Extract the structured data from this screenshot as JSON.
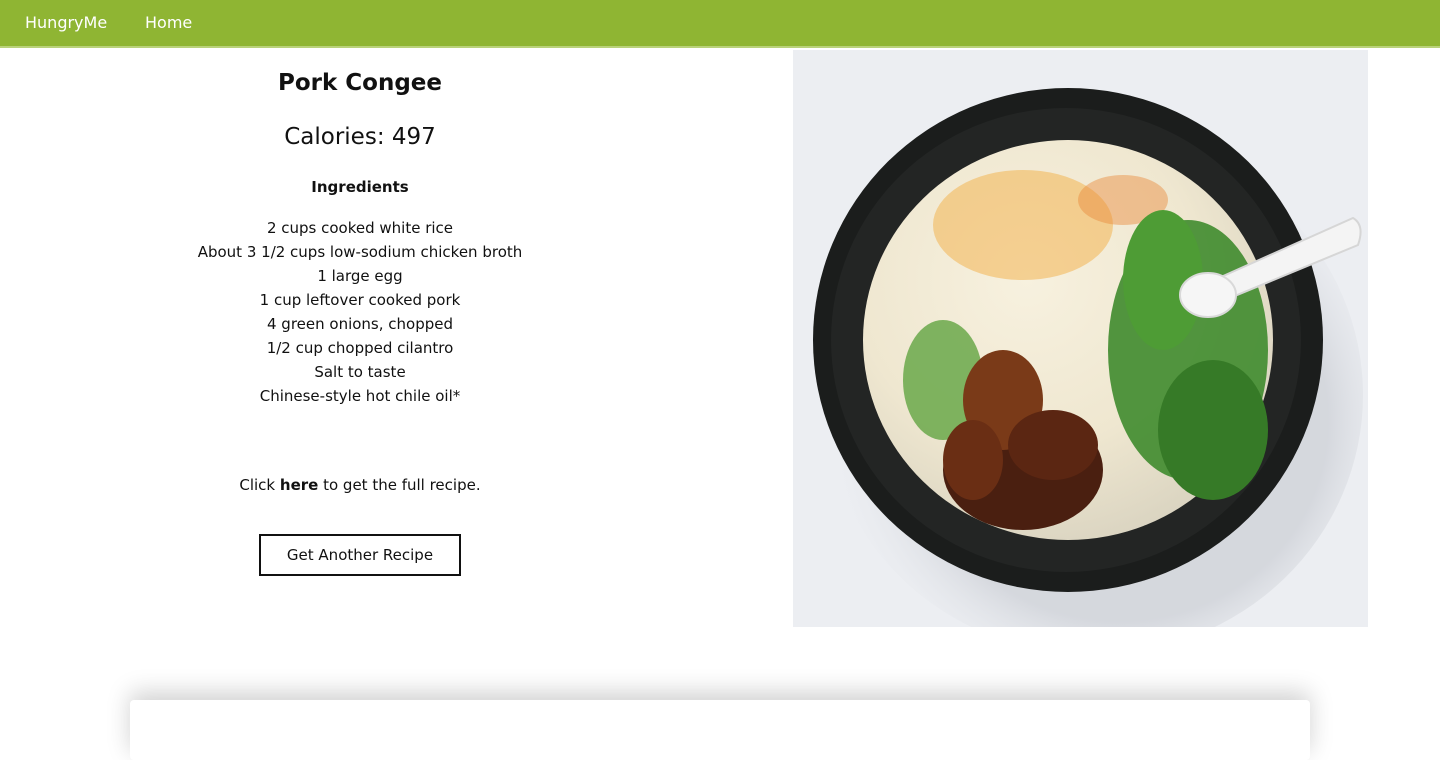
{
  "nav": {
    "brand": "HungryMe",
    "home": "Home"
  },
  "colors": {
    "navbar": "#8fb533",
    "text": "#111111"
  },
  "recipe": {
    "title": "Pork Congee",
    "calories": "Calories: 497",
    "ingredients_heading": "Ingredients",
    "ingredients": [
      "2 cups cooked white rice",
      "About 3 1/2 cups low-sodium chicken broth",
      "1 large egg",
      "1 cup leftover cooked pork",
      "4 green onions, chopped",
      "1/2 cup chopped cilantro",
      "Salt to taste",
      "Chinese-style hot chile oil*"
    ],
    "cta_prefix": "Click ",
    "cta_link": "here",
    "cta_suffix": " to get the full recipe.",
    "another_button": "Get Another Recipe"
  },
  "image": {
    "icon": "recipe-photo-congee-bowl"
  }
}
